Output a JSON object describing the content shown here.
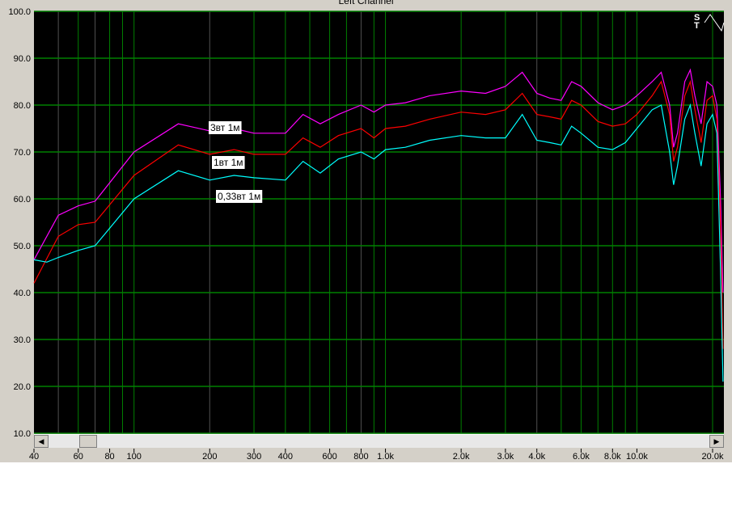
{
  "window_title": "Left Channel",
  "chart_data": {
    "type": "line",
    "title": "Left Channel",
    "xscale": "log",
    "xlim": [
      40,
      22000
    ],
    "ylim": [
      10,
      100
    ],
    "grid": true,
    "background": "#000000",
    "grid_color": "#008000",
    "y_ticks": [
      "100.0",
      "90.0",
      "80.0",
      "70.0",
      "60.0",
      "50.0",
      "40.0",
      "30.0",
      "20.0",
      "10.0"
    ],
    "y_tick_values": [
      100,
      90,
      80,
      70,
      60,
      50,
      40,
      30,
      20,
      10
    ],
    "x_ticks": [
      "40",
      "60",
      "80",
      "100",
      "200",
      "300",
      "400",
      "600",
      "800",
      "1.0k",
      "2.0k",
      "3.0k",
      "4.0k",
      "6.0k",
      "8.0k",
      "10.0k",
      "20.0k"
    ],
    "x_tick_values": [
      40,
      60,
      80,
      100,
      200,
      300,
      400,
      600,
      800,
      1000,
      2000,
      3000,
      4000,
      6000,
      8000,
      10000,
      20000
    ],
    "series": [
      {
        "name": "3вт 1м",
        "color": "#ff00ff",
        "points": [
          [
            40,
            47
          ],
          [
            50,
            56.5
          ],
          [
            60,
            58.5
          ],
          [
            70,
            59.5
          ],
          [
            100,
            70
          ],
          [
            150,
            76
          ],
          [
            200,
            74.5
          ],
          [
            250,
            75
          ],
          [
            300,
            74
          ],
          [
            400,
            74
          ],
          [
            470,
            78
          ],
          [
            550,
            76
          ],
          [
            650,
            78
          ],
          [
            800,
            80
          ],
          [
            900,
            78.5
          ],
          [
            1000,
            80
          ],
          [
            1200,
            80.5
          ],
          [
            1500,
            82
          ],
          [
            2000,
            83
          ],
          [
            2500,
            82.5
          ],
          [
            3000,
            84
          ],
          [
            3500,
            87
          ],
          [
            4000,
            82.5
          ],
          [
            4500,
            81.5
          ],
          [
            5000,
            81
          ],
          [
            5500,
            85
          ],
          [
            6000,
            84
          ],
          [
            7000,
            80.5
          ],
          [
            8000,
            79
          ],
          [
            9000,
            80
          ],
          [
            10000,
            82
          ],
          [
            11500,
            85
          ],
          [
            12500,
            87
          ],
          [
            13500,
            80
          ],
          [
            14000,
            71
          ],
          [
            14500,
            74
          ],
          [
            15500,
            85
          ],
          [
            16300,
            87.5
          ],
          [
            17000,
            82
          ],
          [
            18000,
            76
          ],
          [
            19000,
            85
          ],
          [
            20000,
            84
          ],
          [
            20800,
            80
          ],
          [
            21500,
            60
          ],
          [
            22000,
            40
          ]
        ]
      },
      {
        "name": "1вт 1м",
        "color": "#ff0000",
        "points": [
          [
            40,
            42
          ],
          [
            50,
            52
          ],
          [
            60,
            54.5
          ],
          [
            70,
            55
          ],
          [
            100,
            65
          ],
          [
            150,
            71.5
          ],
          [
            200,
            69.5
          ],
          [
            250,
            70.5
          ],
          [
            300,
            69.5
          ],
          [
            400,
            69.5
          ],
          [
            470,
            73
          ],
          [
            550,
            71
          ],
          [
            650,
            73.5
          ],
          [
            800,
            75
          ],
          [
            900,
            73
          ],
          [
            1000,
            75
          ],
          [
            1200,
            75.5
          ],
          [
            1500,
            77
          ],
          [
            2000,
            78.5
          ],
          [
            2500,
            78
          ],
          [
            3000,
            79
          ],
          [
            3500,
            82.5
          ],
          [
            4000,
            78
          ],
          [
            4500,
            77.5
          ],
          [
            5000,
            77
          ],
          [
            5500,
            81
          ],
          [
            6000,
            80
          ],
          [
            7000,
            76.5
          ],
          [
            8000,
            75.5
          ],
          [
            9000,
            76
          ],
          [
            10000,
            78
          ],
          [
            11500,
            82
          ],
          [
            12500,
            85
          ],
          [
            13500,
            78
          ],
          [
            14000,
            68
          ],
          [
            14500,
            71
          ],
          [
            15500,
            82
          ],
          [
            16300,
            85
          ],
          [
            17000,
            79
          ],
          [
            18000,
            72
          ],
          [
            19000,
            81
          ],
          [
            20000,
            82
          ],
          [
            20800,
            77
          ],
          [
            21500,
            55
          ],
          [
            22000,
            28
          ]
        ]
      },
      {
        "name": "0,33вт 1м",
        "color": "#00ffff",
        "points": [
          [
            40,
            47
          ],
          [
            45,
            46.5
          ],
          [
            50,
            47.5
          ],
          [
            60,
            49
          ],
          [
            70,
            50
          ],
          [
            100,
            60
          ],
          [
            150,
            66
          ],
          [
            200,
            64
          ],
          [
            250,
            65
          ],
          [
            300,
            64.5
          ],
          [
            400,
            64
          ],
          [
            470,
            68
          ],
          [
            550,
            65.5
          ],
          [
            650,
            68.5
          ],
          [
            800,
            70
          ],
          [
            900,
            68.5
          ],
          [
            1000,
            70.5
          ],
          [
            1200,
            71
          ],
          [
            1500,
            72.5
          ],
          [
            2000,
            73.5
          ],
          [
            2500,
            73
          ],
          [
            3000,
            73
          ],
          [
            3500,
            78
          ],
          [
            4000,
            72.5
          ],
          [
            4500,
            72
          ],
          [
            5000,
            71.5
          ],
          [
            5500,
            75.5
          ],
          [
            6000,
            74
          ],
          [
            7000,
            71
          ],
          [
            8000,
            70.5
          ],
          [
            9000,
            72
          ],
          [
            10000,
            75
          ],
          [
            11500,
            79
          ],
          [
            12500,
            80
          ],
          [
            13500,
            70
          ],
          [
            14000,
            63
          ],
          [
            14500,
            67
          ],
          [
            15500,
            77
          ],
          [
            16300,
            80
          ],
          [
            17000,
            74
          ],
          [
            18000,
            67
          ],
          [
            19000,
            76
          ],
          [
            20000,
            78
          ],
          [
            20800,
            74
          ],
          [
            21500,
            45
          ],
          [
            22000,
            21
          ]
        ]
      }
    ],
    "annotations": [
      "3вт 1м",
      "1вт 1м",
      "0,33вт 1м"
    ]
  },
  "icon": "stereo-sine-icon"
}
